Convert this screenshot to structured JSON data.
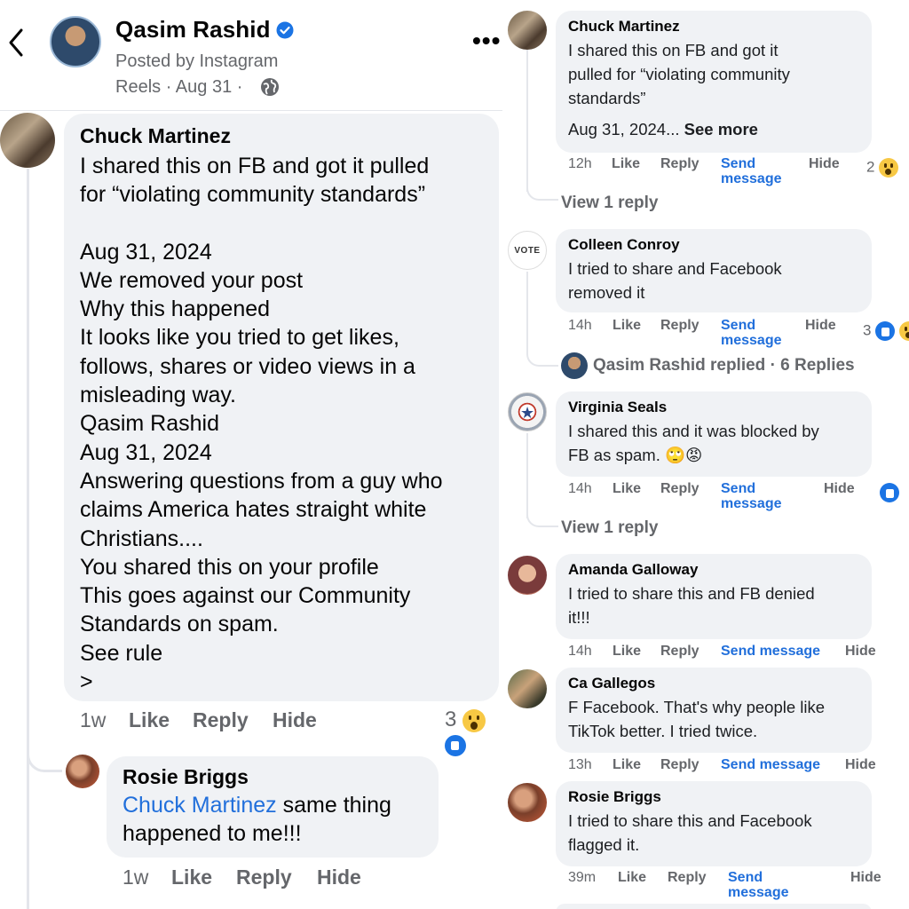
{
  "left": {
    "header": {
      "name": "Qasim Rashid",
      "posted_by": "Posted by Instagram",
      "meta": "Reels · Aug 31 ·",
      "more": "•••"
    },
    "comment1": {
      "author": "Chuck Martinez",
      "lines_a": [
        "I shared this on FB and got it pulled",
        "for “violating community standards”"
      ],
      "lines_b": [
        "Aug 31, 2024",
        "We removed your post",
        "Why this happened",
        "It looks like you tried to get likes,",
        "follows, shares or video views in a",
        "misleading way.",
        "Qasim Rashid",
        "Aug 31, 2024",
        "Answering questions from a guy who",
        "claims America hates straight white",
        "Christians....",
        "You shared this on your profile",
        "This goes against our Community",
        "Standards on spam.",
        "See rule",
        ">"
      ],
      "time": "1w",
      "like": "Like",
      "reply": "Reply",
      "hide": "Hide",
      "reaction_count": "3"
    },
    "comment2": {
      "author": "Rosie Briggs",
      "mention": "Chuck Martinez",
      "text_after_mention": " same thing",
      "line2": "happened to me!!!",
      "time": "1w",
      "like": "Like",
      "reply": "Reply",
      "hide": "Hide"
    }
  },
  "right": {
    "comments": [
      {
        "author": "Chuck Martinez",
        "lines": [
          "I shared this on FB and got it",
          "pulled for “violating community",
          "standards”"
        ],
        "extra_date": "Aug 31, 2024...",
        "see_more": "See more",
        "time": "12h",
        "like": "Like",
        "reply": "Reply",
        "send": "Send",
        "send2": "message",
        "hide": "Hide",
        "reaction_count": "2",
        "view_reply": "View 1 reply"
      },
      {
        "author": "Colleen Conroy",
        "lines": [
          "I tried to share and Facebook",
          "removed it"
        ],
        "time": "14h",
        "like": "Like",
        "reply": "Reply",
        "send": "Send",
        "send2": "message",
        "hide": "Hide",
        "reaction_count": "3",
        "replied": "Qasim Rashid replied · 6 Replies",
        "avatar_text": "VOTE"
      },
      {
        "author": "Virginia Seals",
        "lines": [
          "I shared this and it was blocked by",
          "FB as spam. 🙄😡"
        ],
        "time": "14h",
        "like": "Like",
        "reply": "Reply",
        "send": "Send",
        "send2": "message",
        "hide": "Hide",
        "view_reply": "View 1 reply"
      },
      {
        "author": "Amanda Galloway",
        "lines": [
          "I tried to share this and FB denied",
          "it!!!"
        ],
        "time": "14h",
        "like": "Like",
        "reply": "Reply",
        "send": "Send message",
        "hide": "Hide"
      },
      {
        "author": "Ca Gallegos",
        "lines": [
          "F Facebook. That's why people like",
          "TikTok better. I tried twice."
        ],
        "time": "13h",
        "like": "Like",
        "reply": "Reply",
        "send": "Send message",
        "hide": "Hide"
      },
      {
        "author": "Rosie Briggs",
        "lines": [
          "I tried to share this and Facebook",
          "flagged it."
        ],
        "time": "39m",
        "like": "Like",
        "reply": "Reply",
        "send": "Send",
        "send2": "message",
        "hide": "Hide"
      }
    ]
  },
  "colors": {
    "link": "#216fdb",
    "bubble": "#f0f2f5",
    "muted": "#65676b",
    "like_blue": "#1b74e4",
    "wow_yellow": "#f7c844"
  }
}
